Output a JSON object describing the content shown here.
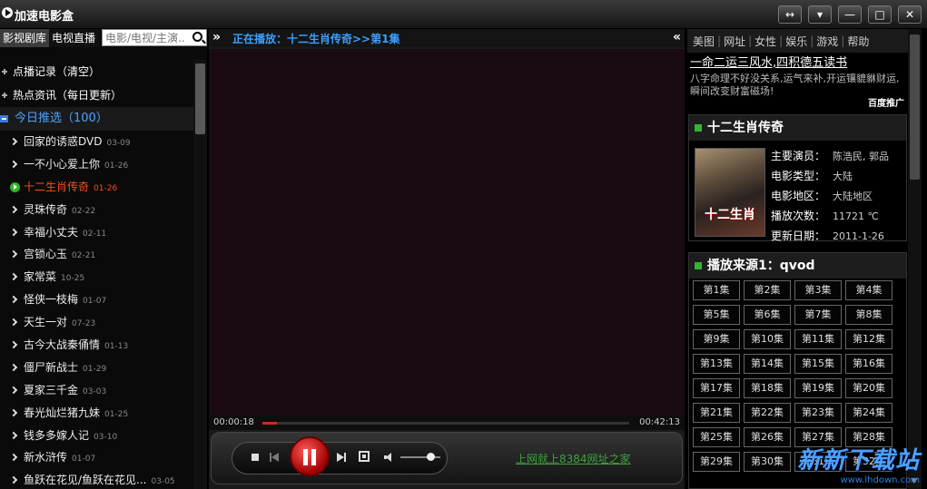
{
  "window": {
    "title": "加速电影盒",
    "buttons": [
      "↔",
      "▾",
      "—",
      "□",
      "✕"
    ]
  },
  "left": {
    "tabs": [
      {
        "label": "影视剧库",
        "active": true
      },
      {
        "label": "电视直播",
        "active": false
      }
    ],
    "search_placeholder": "电影/电视/主演...",
    "sections": [
      {
        "label": "点播记录（清空）"
      },
      {
        "label": "热点资讯（每日更新）"
      }
    ],
    "today": {
      "label": "今日推选（100）"
    },
    "items": [
      {
        "title": "回家的诱惑DVD",
        "date": "03-09"
      },
      {
        "title": "一不小心爱上你",
        "date": "01-26"
      },
      {
        "title": "十二生肖传奇",
        "date": "01-26",
        "playing": true
      },
      {
        "title": "灵珠传奇",
        "date": "02-22"
      },
      {
        "title": "幸福小丈夫",
        "date": "02-11"
      },
      {
        "title": "宫锁心玉",
        "date": "02-21"
      },
      {
        "title": "家常菜",
        "date": "10-25"
      },
      {
        "title": "怪侠一枝梅",
        "date": "01-07"
      },
      {
        "title": "天生一对",
        "date": "07-23"
      },
      {
        "title": "古今大战秦俑情",
        "date": "01-13"
      },
      {
        "title": "僵尸新战士",
        "date": "01-29"
      },
      {
        "title": "夏家三千金",
        "date": "03-03"
      },
      {
        "title": "春光灿烂猪九妹",
        "date": "01-25"
      },
      {
        "title": "钱多多嫁人记",
        "date": "03-10"
      },
      {
        "title": "新水浒传",
        "date": "01-07"
      },
      {
        "title": "鱼跃在花见/鱼跃在花见...",
        "date": "03-05"
      }
    ]
  },
  "center": {
    "now_playing": "正在播放：十二生肖传奇>>第1集",
    "collapse_left": "»",
    "collapse_right": "«",
    "time_current": "00:00:18",
    "time_total": "00:42:13",
    "progress": 0.007,
    "volume": 0.75,
    "ad_link": "上网就上8384网址之家"
  },
  "right": {
    "nav": [
      "美图",
      "网址",
      "女性",
      "娱乐",
      "游戏",
      "帮助"
    ],
    "ad": {
      "title": "一命二运三风水,四积德五读书",
      "text": "八字命理不好没关系,运气来补,开运镶貔貅财运,瞬间改变财富磁场!",
      "badge": "百度推广"
    },
    "show": {
      "title": "十二生肖传奇",
      "poster_text": "十二生肖",
      "fields": [
        {
          "key": "主要演员：",
          "value": "陈浩民, 郭品"
        },
        {
          "key": "电影类型：",
          "value": "大陆"
        },
        {
          "key": "电影地区：",
          "value": "大陆地区"
        },
        {
          "key": "播放次数：",
          "value": "11721 ℃"
        },
        {
          "key": "更新日期：",
          "value": "2011-1-26"
        }
      ]
    },
    "source_title": "播放来源1：qvod",
    "episodes": [
      "第1集",
      "第2集",
      "第3集",
      "第4集",
      "第5集",
      "第6集",
      "第7集",
      "第8集",
      "第9集",
      "第10集",
      "第11集",
      "第12集",
      "第13集",
      "第14集",
      "第15集",
      "第16集",
      "第17集",
      "第18集",
      "第19集",
      "第20集",
      "第21集",
      "第22集",
      "第23集",
      "第24集",
      "第25集",
      "第26集",
      "第27集",
      "第28集",
      "第29集",
      "第30集",
      "第31集",
      "第32集"
    ]
  },
  "watermark": {
    "big": "新新下载站",
    "small": "www.lhdown.com"
  }
}
